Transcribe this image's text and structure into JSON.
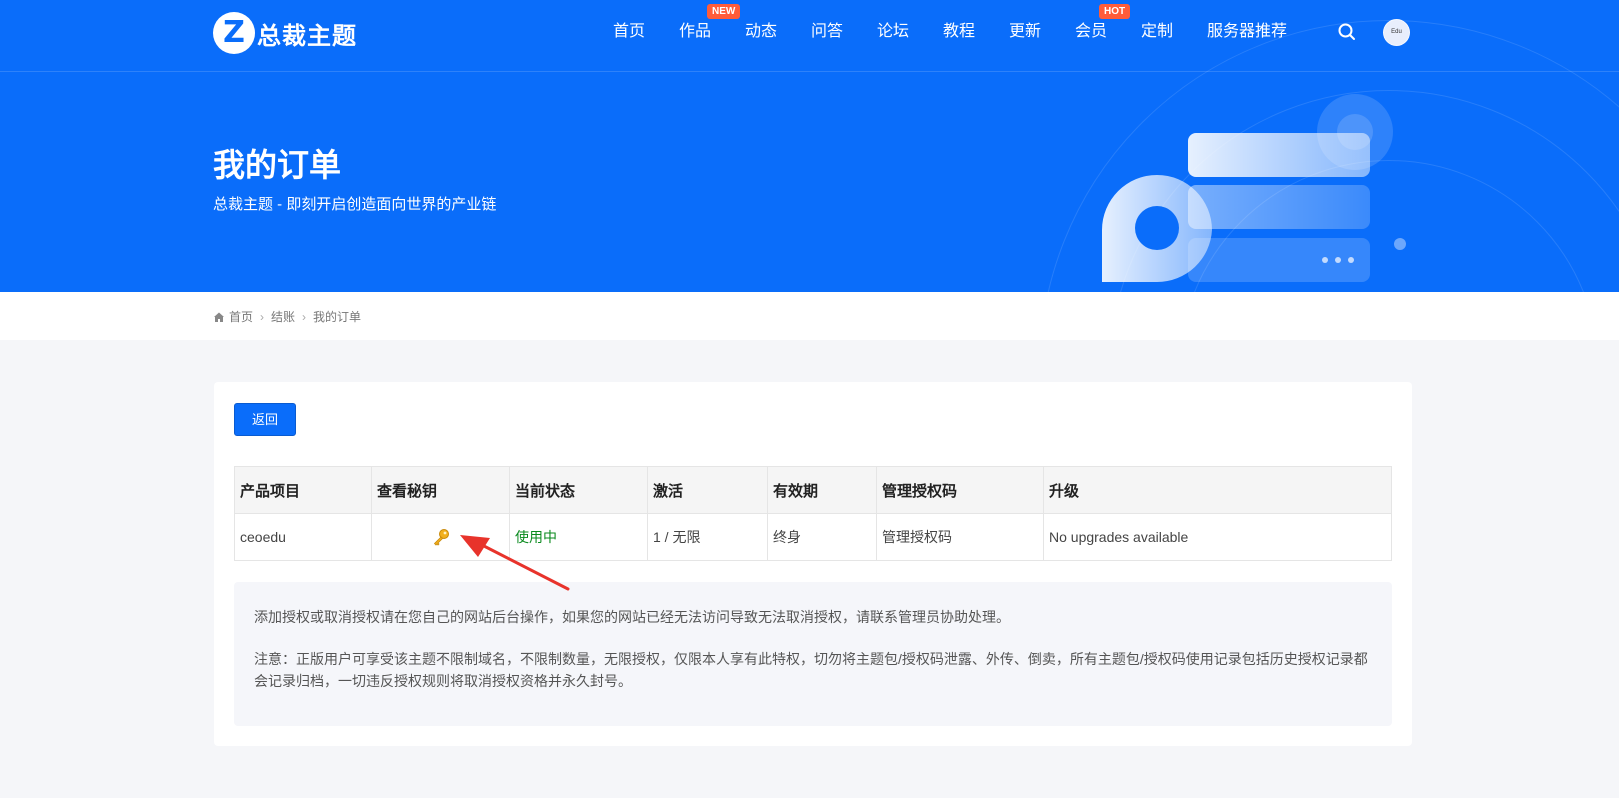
{
  "header": {
    "logo_letter": "Z",
    "logo_text": "总裁主题",
    "nav": [
      {
        "label": "首页",
        "badge": ""
      },
      {
        "label": "作品",
        "badge": "NEW"
      },
      {
        "label": "动态",
        "badge": ""
      },
      {
        "label": "问答",
        "badge": ""
      },
      {
        "label": "论坛",
        "badge": ""
      },
      {
        "label": "教程",
        "badge": ""
      },
      {
        "label": "更新",
        "badge": ""
      },
      {
        "label": "会员",
        "badge": "HOT"
      },
      {
        "label": "定制",
        "badge": ""
      },
      {
        "label": "服务器推荐",
        "badge": ""
      }
    ],
    "search_icon": "search-icon",
    "avatar_text": "Edu"
  },
  "hero": {
    "title": "我的订单",
    "subtitle": "总裁主题 - 即刻开启创造面向世界的产业链"
  },
  "breadcrumb": {
    "items": [
      "首页",
      "结账",
      "我的订单"
    ]
  },
  "main": {
    "back_label": "返回",
    "table": {
      "headers": [
        "产品项目",
        "查看秘钥",
        "当前状态",
        "激活",
        "有效期",
        "管理授权码",
        "升级"
      ],
      "rows": [
        {
          "product": "ceoedu",
          "key_icon": "key-icon",
          "status": "使用中",
          "activation": "1 / 无限",
          "validity": "终身",
          "manage": "管理授权码",
          "upgrade": "No upgrades available"
        }
      ]
    },
    "notice": [
      "添加授权或取消授权请在您自己的网站后台操作，如果您的网站已经无法访问导致无法取消授权，请联系管理员协助处理。",
      "注意：正版用户可享受该主题不限制域名，不限制数量，无限授权，仅限本人享有此特权，切勿将主题包/授权码泄露、外传、倒卖，所有主题包/授权码使用记录包括历史授权记录都会记录归档，一切违反授权规则将取消授权资格并永久封号。"
    ]
  },
  "colors": {
    "primary": "#0a6dfa",
    "badge": "#ff5c39",
    "status_active": "#0a8a1e",
    "annotation_arrow": "#e8332b"
  }
}
